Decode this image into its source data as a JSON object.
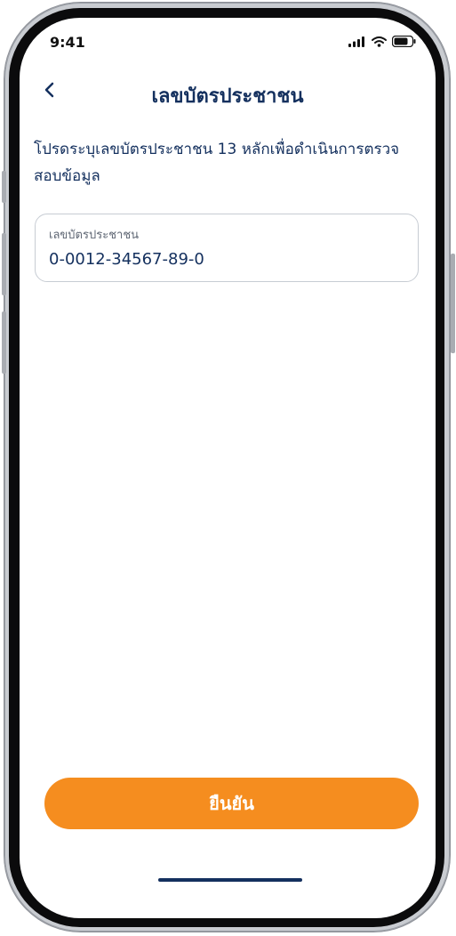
{
  "status_bar": {
    "time": "9:41"
  },
  "header": {
    "title": "เลขบัตรประชาชน"
  },
  "instruction": "โปรดระบุเลขบัตรประชาชน 13 หลักเพื่อดำเนินการตรวจสอบข้อมูล",
  "id_field": {
    "label": "เลขบัตรประชาชน",
    "value": "0-0012-34567-89-0"
  },
  "confirm_button": {
    "label": "ยืนยัน"
  },
  "colors": {
    "primary_text": "#14305e",
    "accent": "#f58d1f"
  },
  "icons": [
    "back-chevron-icon",
    "signal-icon",
    "wifi-icon",
    "battery-icon"
  ]
}
